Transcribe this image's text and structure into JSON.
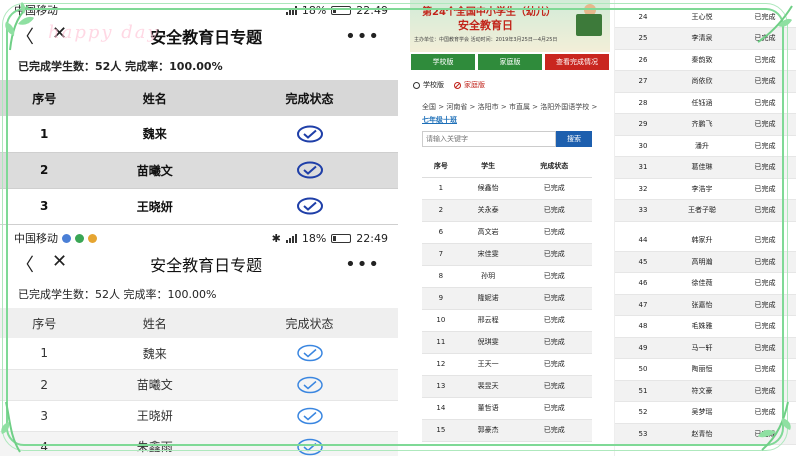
{
  "statusbar": {
    "carrier": "中国移动",
    "battery": "18%",
    "time": "22:49"
  },
  "phone_page": {
    "title": "安全教育日专题",
    "back_icon": "chevron-left-icon",
    "close_icon": "close-icon",
    "more_icon": "more-icon",
    "summary": "已完成学生数：52人  完成率：100.00%",
    "headers": [
      "序号",
      "姓名",
      "完成状态"
    ],
    "rows": [
      {
        "no": "1",
        "name": "魏来"
      },
      {
        "no": "2",
        "name": "苗曦文"
      },
      {
        "no": "3",
        "name": "王晓妍"
      },
      {
        "no": "4",
        "name": "朱鑫雨"
      }
    ],
    "status_icon": "check-circle-icon"
  },
  "decoration": {
    "text": "happy day"
  },
  "web_page": {
    "banner_title": "第24个全国中小学生（幼儿）",
    "banner_subtitle": "安全教育日",
    "banner_meta": "主办单位：中国教育学会  活动时间：2019年3月25日—4月25日",
    "tabs": [
      "学校版",
      "家庭版",
      "查看完成情况"
    ],
    "radio_school": "学校版",
    "radio_home": "家庭版",
    "breadcrumb": "全国 > 河南省 > 洛阳市 > 市直属 > 洛阳外国语学校 >",
    "class_name": "七年级十班",
    "search_placeholder": "请输入关键字",
    "search_button": "搜索",
    "headers": [
      "序号",
      "学生",
      "完成状态"
    ],
    "status_text": "已完成",
    "rows": [
      {
        "no": "1",
        "name": "候鑫怡"
      },
      {
        "no": "2",
        "name": "关永泰"
      },
      {
        "no": "6",
        "name": "高文岩"
      },
      {
        "no": "7",
        "name": "宋佳雯"
      },
      {
        "no": "8",
        "name": "孙玥"
      },
      {
        "no": "9",
        "name": "隆妮诺"
      },
      {
        "no": "10",
        "name": "邢云程"
      },
      {
        "no": "11",
        "name": "倪琪雯"
      },
      {
        "no": "12",
        "name": "王天一"
      },
      {
        "no": "13",
        "name": "裴昱天"
      },
      {
        "no": "14",
        "name": "董哲语"
      },
      {
        "no": "15",
        "name": "郭豪杰"
      }
    ]
  },
  "right_list": {
    "status_text": "已完成",
    "group1": [
      {
        "no": "24",
        "name": "王心悦"
      },
      {
        "no": "25",
        "name": "李清泉"
      },
      {
        "no": "26",
        "name": "秦韵致"
      },
      {
        "no": "27",
        "name": "尚依欣"
      },
      {
        "no": "28",
        "name": "任钰涵"
      },
      {
        "no": "29",
        "name": "齐鹏飞"
      },
      {
        "no": "30",
        "name": "潘升"
      },
      {
        "no": "31",
        "name": "葛佳琳"
      },
      {
        "no": "32",
        "name": "李浩宇"
      },
      {
        "no": "33",
        "name": "王者子聪"
      }
    ],
    "group2": [
      {
        "no": "44",
        "name": "韩家升"
      },
      {
        "no": "45",
        "name": "高明瀚"
      },
      {
        "no": "46",
        "name": "徐佳薇"
      },
      {
        "no": "47",
        "name": "张嘉怡"
      },
      {
        "no": "48",
        "name": "毛姝雅"
      },
      {
        "no": "49",
        "name": "马一轩"
      },
      {
        "no": "50",
        "name": "陶丽恒"
      },
      {
        "no": "51",
        "name": "符文豪"
      },
      {
        "no": "52",
        "name": "吴梦瑶"
      },
      {
        "no": "53",
        "name": "赵青怡"
      }
    ]
  }
}
